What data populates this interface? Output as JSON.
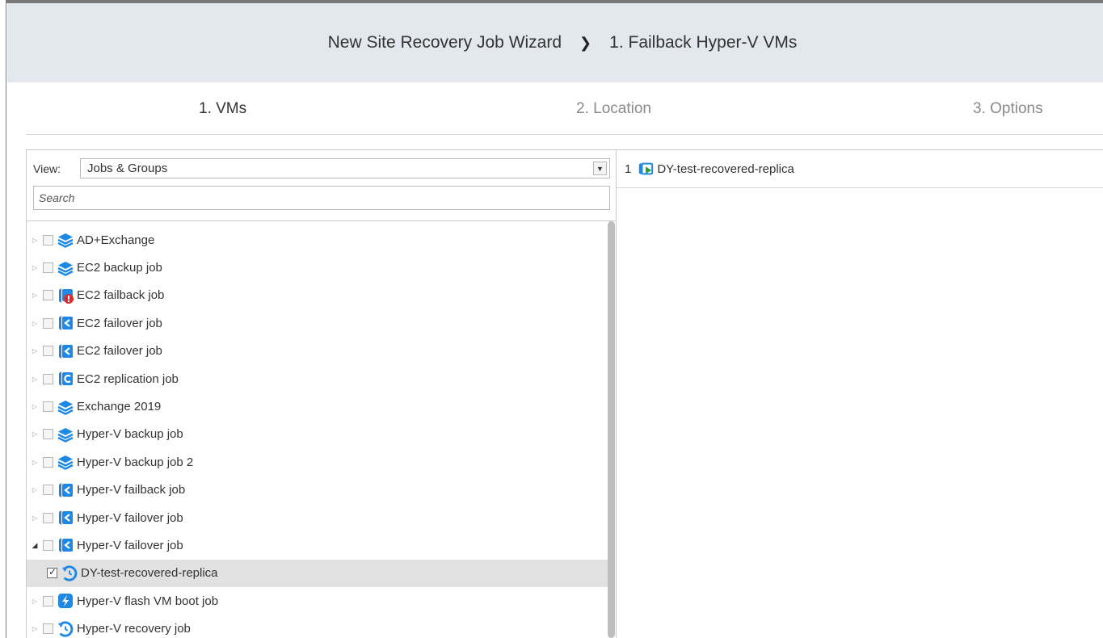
{
  "header": {
    "wizard_title": "New Site Recovery Job Wizard",
    "chevron": "›",
    "step_title": "1. Failback Hyper-V VMs"
  },
  "steps": [
    {
      "label": "1. VMs",
      "active": true
    },
    {
      "label": "2. Location",
      "active": false
    },
    {
      "label": "3. Options",
      "active": false
    }
  ],
  "view": {
    "label": "View:",
    "selected": "Jobs & Groups",
    "search_placeholder": "Search"
  },
  "tree": [
    {
      "label": "AD+Exchange",
      "icon": "backup-job-icon",
      "expanded": false,
      "checked": false
    },
    {
      "label": "EC2 backup job",
      "icon": "backup-job-icon",
      "expanded": false,
      "checked": false
    },
    {
      "label": "EC2 failback job",
      "icon": "failback-job-error-icon",
      "expanded": false,
      "checked": false
    },
    {
      "label": "EC2 failover job",
      "icon": "failover-job-icon",
      "expanded": false,
      "checked": false
    },
    {
      "label": "EC2 failover job",
      "icon": "failover-job-icon",
      "expanded": false,
      "checked": false
    },
    {
      "label": "EC2 replication job",
      "icon": "replication-job-icon",
      "expanded": false,
      "checked": false
    },
    {
      "label": "Exchange 2019",
      "icon": "backup-job-icon",
      "expanded": false,
      "checked": false
    },
    {
      "label": "Hyper-V backup job",
      "icon": "backup-job-icon",
      "expanded": false,
      "checked": false
    },
    {
      "label": "Hyper-V backup job 2",
      "icon": "backup-job-icon",
      "expanded": false,
      "checked": false
    },
    {
      "label": "Hyper-V failback job",
      "icon": "failover-job-icon",
      "expanded": false,
      "checked": false
    },
    {
      "label": "Hyper-V failover job",
      "icon": "failover-job-icon",
      "expanded": false,
      "checked": false
    },
    {
      "label": "Hyper-V failover job",
      "icon": "failover-job-icon",
      "expanded": true,
      "checked": false
    },
    {
      "label": "DY-test-recovered-replica",
      "icon": "vm-recovered-icon",
      "child": true,
      "checked": true
    },
    {
      "label": "Hyper-V flash VM boot job",
      "icon": "flash-boot-icon",
      "expanded": false,
      "checked": false
    },
    {
      "label": "Hyper-V recovery job",
      "icon": "recovery-job-icon",
      "expanded": false,
      "checked": false
    }
  ],
  "selected_items": [
    {
      "index": "1",
      "label": "DY-test-recovered-replica",
      "icon": "replica-vm-icon"
    }
  ],
  "colors": {
    "header_bg": "#e3e7ee",
    "accent_blue": "#1e88e5",
    "error_red": "#d32f2f",
    "replica_green": "#2e9e3e"
  }
}
